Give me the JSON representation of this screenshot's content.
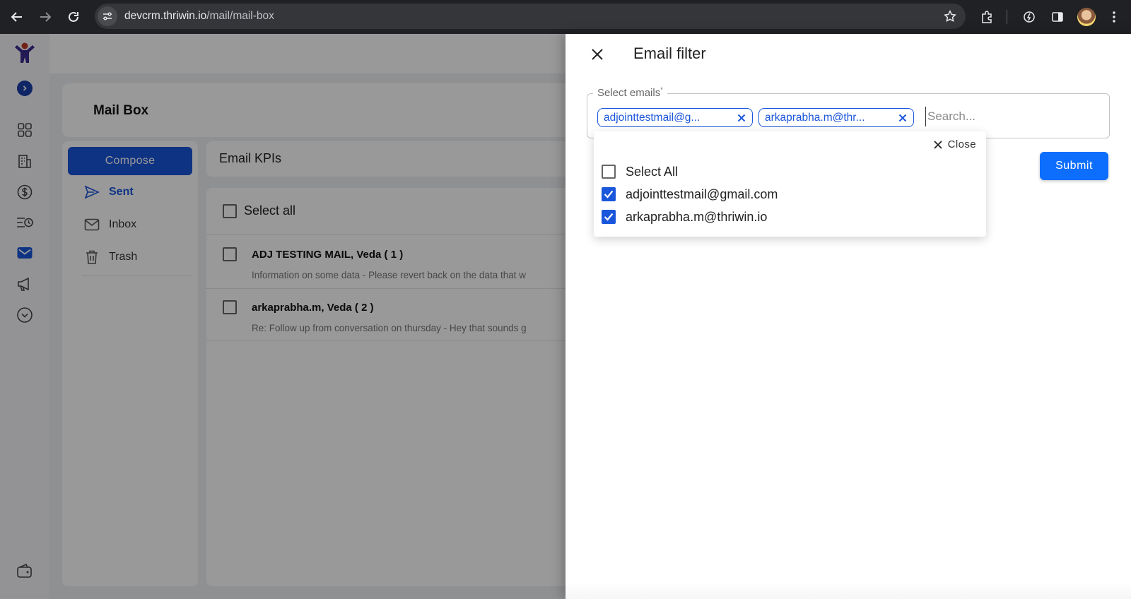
{
  "browser": {
    "url_host": "devcrm.thriwin.io",
    "url_path": "/mail/mail-box"
  },
  "page": {
    "title": "Mail Box",
    "compose_label": "Compose",
    "nav": [
      {
        "label": "Sent",
        "icon": "send-icon",
        "active": true
      },
      {
        "label": "Inbox",
        "icon": "mail-icon",
        "active": false
      },
      {
        "label": "Trash",
        "icon": "trash-icon",
        "active": false
      }
    ],
    "kpi_title": "Email KPIs",
    "select_all_label": "Select all",
    "mails": [
      {
        "from": "ADJ TESTING MAIL,   Veda ( 1 )",
        "snippet": "Information on some data -  Please revert back on the data that w"
      },
      {
        "from": "arkaprabha.m,   Veda ( 2 )",
        "snippet": "Re: Follow up from conversation on thursday -  Hey that sounds g"
      }
    ]
  },
  "drawer": {
    "title": "Email filter",
    "field_label": "Select emails",
    "required_mark": "*",
    "chips": [
      {
        "label": "adjointtestmail@g..."
      },
      {
        "label": "arkaprabha.m@thr..."
      }
    ],
    "search_placeholder": "Search...",
    "submit_label": "Submit",
    "dropdown": {
      "close_label": "Close",
      "options": [
        {
          "label": "Select All",
          "checked": false
        },
        {
          "label": "adjointtestmail@gmail.com",
          "checked": true
        },
        {
          "label": "arkaprabha.m@thriwin.io",
          "checked": true
        }
      ]
    }
  },
  "colors": {
    "accent": "#1a56db",
    "submit": "#0d6efd",
    "chrome_bg": "#202124"
  }
}
